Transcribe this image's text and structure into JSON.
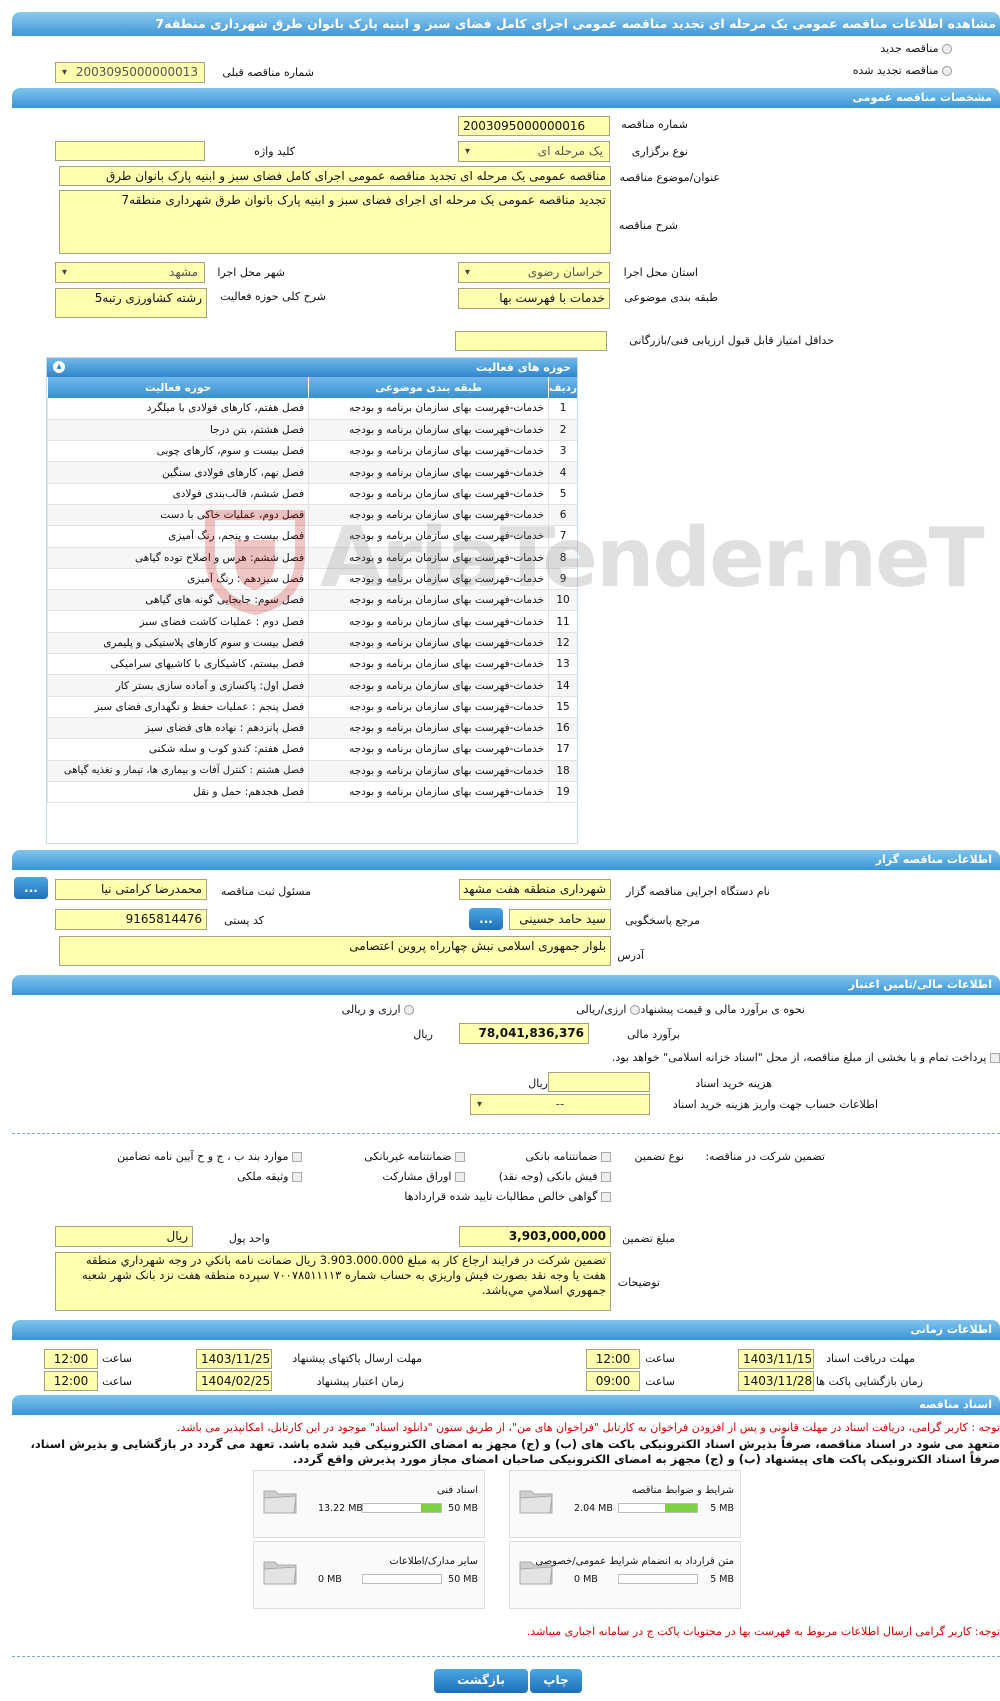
{
  "title": "مشاهده اطلاعات مناقصه عمومی یک مرحله ای تجدید مناقصه عمومی اجرای کامل فضای سبز و ابنیه پارک بانوان طرق شهرداری منطقه7",
  "top": {
    "new_tender": "مناقصه جدید",
    "renewed_tender": "مناقصه تجدید شده",
    "prev_number_label": "شماره مناقصه قبلی",
    "prev_number": "2003095000000013"
  },
  "general": {
    "header": "مشخصات مناقصه عمومی",
    "number_label": "شماره مناقصه",
    "number": "2003095000000016",
    "type_label": "نوع برگزاری",
    "type": "یک مرحله ای",
    "keyword_label": "کلید واژه",
    "keyword": "",
    "subject_label": "عنوان/موضوع مناقصه",
    "subject": "مناقصه عمومی یک مرحله ای تجدید مناقصه عمومی اجرای کامل فضای سبز و ابنیه پارک بانوان طرق",
    "desc_label": "شرح مناقصه",
    "desc": "تجدید مناقصه عمومی یک مرحله ای اجرای فضای سبز و ابنیه پارک بانوان طرق شهرداری منطقه7",
    "province_label": "استان محل اجرا",
    "province": "خراسان رضوی",
    "city_label": "شهر محل اجرا",
    "city": "مشهد",
    "category_label": "طبقه بندی موضوعی",
    "category": "خدمات با فهرست بها",
    "scope_label": "شرح کلی حوزه فعالیت",
    "scope": "رشته کشاورزی رتبه5",
    "min_score_label": "حداقل امتیاز قابل قبول ارزیابی فنی/بازرگانی",
    "min_score": ""
  },
  "fields": {
    "header": "حوزه های فعالیت",
    "col_row": "ردیف",
    "col_cat": "طبقه بندی موضوعی",
    "col_field": "حوزه فعالیت",
    "rows": [
      [
        "1",
        "خدمات-فهرست بهای سازمان برنامه و بودجه",
        "فصل هفتم، کارهای فولادی با میلگرد"
      ],
      [
        "2",
        "خدمات-فهرست بهای سازمان برنامه و بودجه",
        "فصل هشتم، بتن درجا"
      ],
      [
        "3",
        "خدمات-فهرست بهای سازمان برنامه و بودجه",
        "فصل بیست و سوم، کارهای چوبی"
      ],
      [
        "4",
        "خدمات-فهرست بهای سازمان برنامه و بودجه",
        "فصل نهم، کارهای فولادی سنگین"
      ],
      [
        "5",
        "خدمات-فهرست بهای سازمان برنامه و بودجه",
        "فصل ششم، قالب‌بندی فولادی"
      ],
      [
        "6",
        "خدمات-فهرست بهای سازمان برنامه و بودجه",
        "فصل دوم، عملیات خاکی با دست"
      ],
      [
        "7",
        "خدمات-فهرست بهای سازمان برنامه و بودجه",
        "فصل بیست و پنجم، رنگ آمیزی"
      ],
      [
        "8",
        "خدمات-فهرست بهای سازمان برنامه و بودجه",
        "فصل ششم: هرس و اصلاح توده گیاهی"
      ],
      [
        "9",
        "خدمات-فهرست بهای سازمان برنامه و بودجه",
        "فصل سیزدهم : رنگ آمیزی"
      ],
      [
        "10",
        "خدمات-فهرست بهای سازمان برنامه و بودجه",
        "فصل سوم: جابجایی گونه های گیاهی"
      ],
      [
        "11",
        "خدمات-فهرست بهای سازمان برنامه و بودجه",
        "فصل دوم : عملیات کاشت فضای سبز"
      ],
      [
        "12",
        "خدمات-فهرست بهای سازمان برنامه و بودجه",
        "فصل بیست و سوم کارهای پلاستیکی و پلیمری"
      ],
      [
        "13",
        "خدمات-فهرست بهای سازمان برنامه و بودجه",
        "فصل بیستم، کاشیکاری با کاشیهای سرامیکی"
      ],
      [
        "14",
        "خدمات-فهرست بهای سازمان برنامه و بودجه",
        "فصل اول:  پاکسازی و آماده سازی بستر کار"
      ],
      [
        "15",
        "خدمات-فهرست بهای سازمان برنامه و بودجه",
        "فصل پنجم : عملیات حفظ و نگهداری فضای سبز"
      ],
      [
        "16",
        "خدمات-فهرست بهای سازمان برنامه و بودجه",
        "فصل پانزدهم : نهاده های فضای سبز"
      ],
      [
        "17",
        "خدمات-فهرست بهای سازمان برنامه و بودجه",
        "فصل هفتم: کندو کوب و سله شکنی"
      ],
      [
        "18",
        "خدمات-فهرست بهای سازمان برنامه و بودجه",
        "فصل هشتم : کنترل آفات و بیماری ها، تیمار و تغذیه گیاهی"
      ],
      [
        "19",
        "خدمات-فهرست بهای سازمان برنامه و بودجه",
        "فصل هجدهم: حمل و نقل"
      ]
    ]
  },
  "organizer": {
    "header": "اطلاعات مناقصه گزار",
    "org_label": "نام دستگاه اجرایی مناقصه گزار",
    "org": "شهرداری منطقه هفت مشهد",
    "resp_label": "مسئول ثبت مناقصه",
    "resp": "محمدرضا کرامتی نیا",
    "ref_label": "مرجع پاسخگویی",
    "ref": "سید حامد حسینی",
    "postal_label": "کد پستی",
    "postal": "9165814476",
    "addr_label": "آدرس",
    "addr": "بلوار جمهوری اسلامی نبش چهارراه پروین اعتصامی",
    "dots": "..."
  },
  "finance": {
    "header": "اطلاعات مالی/تامین اعتبار",
    "method_label": "نحوه ی برآورد مالی و قیمت پیشنهادی",
    "opt1": "ارزی/ریالی",
    "opt2": "ارزی و ریالی",
    "estimate_label": "برآورد مالی",
    "estimate": "78,041,836,376",
    "rial": "ریال",
    "treasury": "پرداخت تمام و یا بخشی از مبلغ مناقصه، از محل \"اسناد خزانه اسلامی\" خواهد بود.",
    "doc_cost_label": "هزینه خرید اسناد",
    "doc_cost": "",
    "doc_acct_label": "اطلاعات حساب جهت واریز هزینه خرید اسناد",
    "doc_acct": "--"
  },
  "guarantee": {
    "part_label": "تضمین شرکت در مناقصه:",
    "type_label": "نوع تضمین",
    "c1": "ضمانتنامه بانکی",
    "c2": "ضمانتنامه غیربانکی",
    "c3": "موارد بند ب ، ج و ح آیین نامه تضامین",
    "c4": "فیش بانکی (وجه نقد)",
    "c5": "اوراق مشارکت",
    "c6": "وثیقه ملکی",
    "c7": "گواهی خالص مطالبات تایید شده قراردادها",
    "amount_label": "مبلغ تضمین",
    "amount": "3,903,000,000",
    "unit_label": "واحد پول",
    "unit": "ریال",
    "notes_label": "توضیحات",
    "notes": "تضمین شرکت در فرايند ارجاع کار به مبلغ 3.903.000.000 ريال ضمانت نامه بانكي در وجه شهرداري منطقه هفت يا وجه نقد بصورت فيش واريزي به حساب شماره ٧٠٠٧٨٥١١١١٣ سپرده منطقه هفت نزد بانک شهر شعبه جمهوري اسلامي مي‌باشد."
  },
  "timing": {
    "header": "اطلاعات زمانی",
    "recv_label": "مهلت دریافت اسناد",
    "recv_date": "1403/11/15",
    "recv_time": "12:00",
    "send_label": "مهلت ارسال پاکتهای پیشنهاد",
    "send_date": "1403/11/25",
    "send_time": "12:00",
    "open_label": "زمان بازگشایی پاکت ها",
    "open_date": "1403/11/28",
    "open_time": "09:00",
    "valid_label": "زمان اعتبار پیشنهاد",
    "valid_date": "1404/02/25",
    "valid_time": "12:00",
    "time_label": "ساعت"
  },
  "docs": {
    "header": "اسناد مناقصه",
    "note1": "توجه : کاربر گرامی، دریافت اسناد در مهلت قانونی و پس از افزودن فراخوان به کارتابل \"فراخوان های من\"، از طریق ستون \"دانلود اسناد\" موجود در این کارتابل، امکانپذیر می باشد.",
    "note2a": "متعهد می شود در اسناد مناقصه، صرفاً بذیرش اسناد الکترونیکی باکت های (ب) و (ج) مجهز به امضای الکترونیکی قید شده باشد. تعهد می گردد در بازگشایی و بذیرش اسناد،",
    "note2b": "صرفاً اسناد الکترونیکی پاکت های پیشنهاد (ب) و (ج) مجهز به امضای الکترونیکی صاحبان امضای مجاز مورد پذیرش واقع گردد.",
    "items": [
      {
        "name": "شرایط و ضوابط مناقصه",
        "size": "2.04 MB",
        "max": "5 MB",
        "pct": 0.41
      },
      {
        "name": "اسناد فنی",
        "size": "13.22 MB",
        "max": "50 MB",
        "pct": 0.26
      },
      {
        "name": "متن قرارداد به انضمام شرایط عمومی/خصوصی",
        "size": "0 MB",
        "max": "5 MB",
        "pct": 0
      },
      {
        "name": "سایر مدارک/اطلاعات",
        "size": "0 MB",
        "max": "50 MB",
        "pct": 0
      }
    ],
    "note3": "توجه: کاربر گرامی ارسال اطلاعات مربوط به فهرست بها در محتویات پاکت ج در سامانه اجباری میباشد."
  },
  "buttons": {
    "print": "چاپ",
    "back": "بازگشت"
  },
  "watermark": "AriaTender.neT"
}
